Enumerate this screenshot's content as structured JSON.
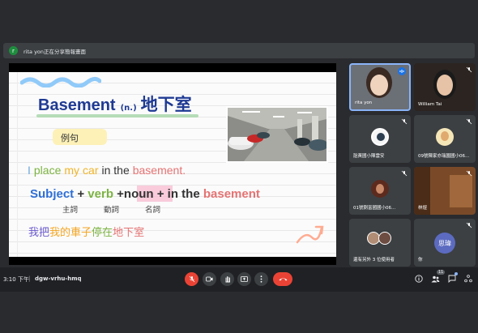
{
  "banner": {
    "avatar_letter": "r",
    "text": "rita yon正在分享簡報畫面"
  },
  "slide": {
    "title_word": "Basement",
    "title_pos": "(n.)",
    "title_zh": "地下室",
    "example_label": "例句",
    "sentence": [
      "I",
      "place",
      "my",
      "car",
      "in the",
      "basement."
    ],
    "pattern": {
      "subject": "Subject",
      "plus1": "+",
      "verb": "verb",
      "plus2": "+",
      "noun": "noun",
      "tail": "+ in the",
      "basement": "basement"
    },
    "roles": {
      "subject": "主詞",
      "verb": "動詞",
      "noun": "名詞"
    },
    "zh_sentence": [
      "我把",
      "我的",
      "車子",
      "停在",
      "地下室"
    ]
  },
  "participants": [
    {
      "name": "rita yon",
      "self": true
    },
    {
      "name": "William Tai"
    },
    {
      "name": "瓰黃國小陳雲安"
    },
    {
      "name": "09號陳家亦瑞園國小06..."
    },
    {
      "name": "01號劉富國國小06..."
    },
    {
      "name": "林煜"
    },
    {
      "name": "還有另外 3 位使用者"
    },
    {
      "name": "你",
      "avatar_text": "思瑋"
    }
  ],
  "bottom": {
    "time": "3:10 下午",
    "separator": "|",
    "meeting_code": "dgw-vrhu-hmq",
    "people_count": "11"
  },
  "colors": {
    "mic_off": "#ea4335",
    "end_call": "#ea4335",
    "brand_blue": "#1f3a93"
  }
}
